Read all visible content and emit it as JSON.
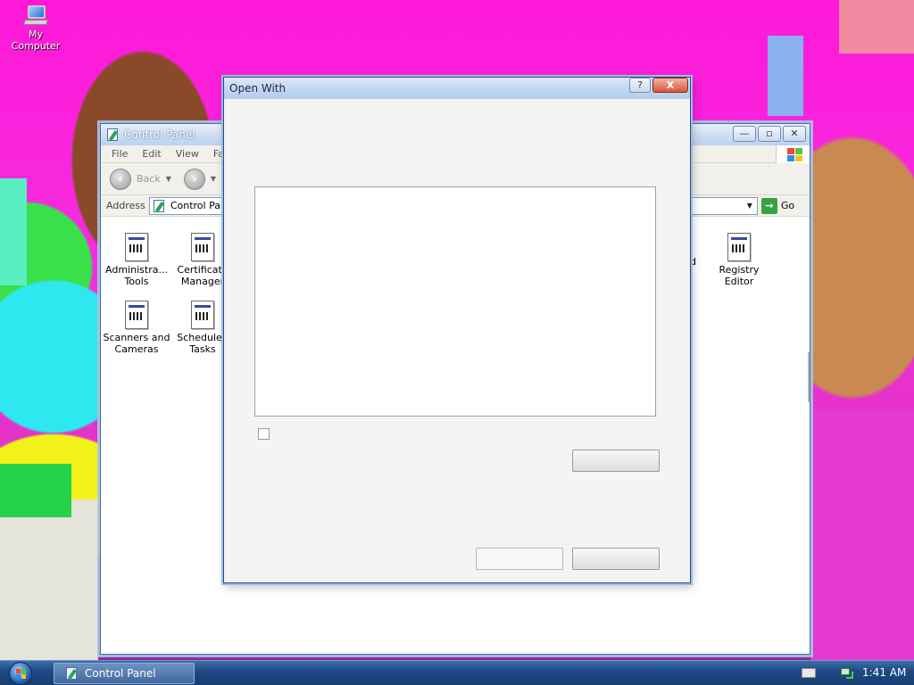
{
  "desktop": {
    "icons": [
      {
        "label": "My Computer",
        "icon": "my-computer-icon"
      }
    ]
  },
  "control_panel": {
    "title": "Control Panel",
    "menu": [
      "File",
      "Edit",
      "View",
      "Fa"
    ],
    "toolbar": {
      "back_label": "Back"
    },
    "address": {
      "label": "Address",
      "value": "Control Pan",
      "go_label": "Go"
    },
    "items": [
      {
        "label": "Administra... Tools",
        "icon": "applet-icon"
      },
      {
        "label": "Certificate Manager",
        "icon": "applet-icon"
      },
      {
        "label": "Registry Editor",
        "icon": "applet-icon"
      },
      {
        "label": "Scanners and Cameras",
        "icon": "applet-icon"
      },
      {
        "label": "Scheduled Tasks",
        "icon": "applet-icon"
      }
    ],
    "partial_label": "d"
  },
  "open_with": {
    "title": "Open With",
    "help_label": "?",
    "close_label": "X"
  },
  "taskbar": {
    "task_label": "Control Panel",
    "clock": "1:41 AM"
  },
  "colors": {
    "taskbar": "#1f4b86",
    "dialog_bg": "#f4f4f4",
    "wallpaper_magenta": "#ff18d8"
  }
}
